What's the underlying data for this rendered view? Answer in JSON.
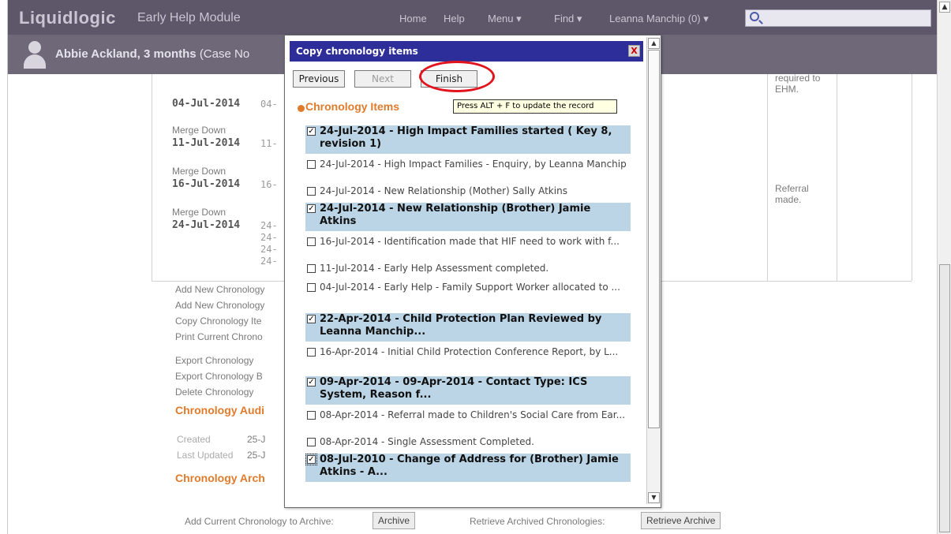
{
  "app": {
    "logo": "Liquidlogic",
    "module": "Early Help Module"
  },
  "nav": {
    "home": "Home",
    "help": "Help",
    "menu": "Menu ▾",
    "find": "Find ▾",
    "user": "Leanna Manchip (0) ▾"
  },
  "case": {
    "name": "Abbie Ackland, 3 months",
    "suffix": "(Case No"
  },
  "background": {
    "rows": [
      {
        "merge": "",
        "date": "04-Jul-2014",
        "short": "04-"
      },
      {
        "merge": "Merge Down",
        "date": "11-Jul-2014",
        "short": "11-"
      },
      {
        "merge": "Merge Down",
        "date": "16-Jul-2014",
        "short": "16-"
      },
      {
        "merge": "Merge Down",
        "date": "24-Jul-2014",
        "short": "24-"
      }
    ],
    "extra_shorts": [
      "24-",
      "24-",
      "24-"
    ],
    "right_notes": [
      "required to",
      "EHM.",
      "Referral",
      "made."
    ],
    "links": [
      "Add New Chronology",
      "Add New Chronology",
      "Copy Chronology Ite",
      "Print Current Chrono",
      "Export Chronology",
      "Export Chronology B",
      "Delete Chronology"
    ],
    "audit_heading": "Chronology Audi",
    "created_label": "Created",
    "created_value": "25-J",
    "updated_label": "Last Updated",
    "updated_value": "25-J",
    "archive_heading": "Chronology Arch",
    "archive_label": "Add Current Chronology to Archive:",
    "archive_button": "Archive",
    "retrieve_label": "Retrieve Archived Chronologies:",
    "retrieve_button": "Retrieve Archive"
  },
  "dialog": {
    "title": "Copy chronology items",
    "close": "X",
    "buttons": {
      "previous": "Previous",
      "next": "Next",
      "finish": "Finish"
    },
    "tooltip": "Press ALT + F to update the record",
    "heading": "Chronology Items",
    "items": [
      {
        "checked": true,
        "text": "24-Jul-2014 - High Impact Families started ( Key 8, revision 1)"
      },
      {
        "checked": false,
        "text": "24-Jul-2014 - High Impact Families - Enquiry, by Leanna Manchip"
      },
      {
        "checked": false,
        "text": "24-Jul-2014 - New Relationship (Mother) Sally Atkins"
      },
      {
        "checked": true,
        "text": "24-Jul-2014 - New Relationship (Brother) Jamie Atkins"
      },
      {
        "checked": false,
        "text": "16-Jul-2014 - Identification made that HIF need to work with f..."
      },
      {
        "checked": false,
        "text": "11-Jul-2014 - Early Help Assessment completed."
      },
      {
        "checked": false,
        "text": "04-Jul-2014 - Early Help - Family Support Worker allocated to ..."
      },
      {
        "checked": true,
        "text": "22-Apr-2014 - Child Protection Plan Reviewed by Leanna Manchip..."
      },
      {
        "checked": false,
        "text": "16-Apr-2014 - Initial Child Protection Conference Report, by L..."
      },
      {
        "checked": true,
        "text": "09-Apr-2014 - 09-Apr-2014 - Contact Type: ICS System, Reason f..."
      },
      {
        "checked": false,
        "text": "08-Apr-2014 - Referral made to Children's Social Care from Ear..."
      },
      {
        "checked": false,
        "text": "08-Apr-2014 - Single Assessment Completed."
      },
      {
        "checked": true,
        "text": "08-Jul-2010 - Change of Address for (Brother) Jamie Atkins - A..."
      }
    ]
  },
  "colors": {
    "header": "#5d5769",
    "subheader": "#6e6879",
    "accent": "#e07b2c",
    "selected_row": "#bcd5e6",
    "dialog_title": "#2e2e9a",
    "highlight_ring": "#e1131c"
  }
}
